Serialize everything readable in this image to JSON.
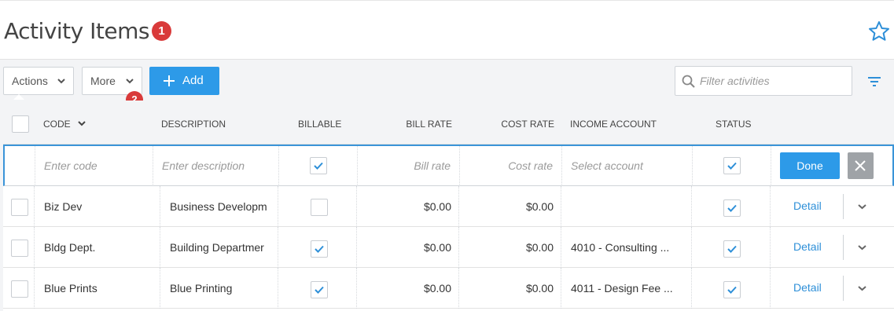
{
  "header": {
    "title": "Activity Items",
    "badge_1": "1"
  },
  "toolbar": {
    "actions_label": "Actions",
    "more_label": "More",
    "badge_2": "2",
    "add_label": "Add",
    "search_placeholder": "Filter activities"
  },
  "table": {
    "columns": {
      "code": "CODE",
      "description": "DESCRIPTION",
      "billable": "BILLABLE",
      "bill_rate": "BILL RATE",
      "cost_rate": "COST RATE",
      "income_account": "INCOME ACCOUNT",
      "status": "STATUS"
    },
    "new_row": {
      "code_placeholder": "Enter code",
      "description_placeholder": "Enter description",
      "billable": true,
      "bill_rate_placeholder": "Bill rate",
      "cost_rate_placeholder": "Cost rate",
      "account_placeholder": "Select account",
      "status": true,
      "done_label": "Done"
    },
    "rows": [
      {
        "code": "Biz Dev",
        "description": "Business Developm",
        "billable": false,
        "bill_rate": "$0.00",
        "cost_rate": "$0.00",
        "income_account": "",
        "status": true,
        "detail_label": "Detail"
      },
      {
        "code": "Bldg Dept.",
        "description": "Building Departmer",
        "billable": true,
        "bill_rate": "$0.00",
        "cost_rate": "$0.00",
        "income_account": "4010 - Consulting ...",
        "status": true,
        "detail_label": "Detail"
      },
      {
        "code": "Blue Prints",
        "description": "Blue Printing",
        "billable": true,
        "bill_rate": "$0.00",
        "cost_rate": "$0.00",
        "income_account": "4011 - Design Fee ...",
        "status": true,
        "detail_label": "Detail"
      }
    ]
  },
  "colors": {
    "accent": "#2d9ae8",
    "badge": "#d93a3a",
    "link": "#2d8fd8",
    "cancel": "#9fa3a7"
  },
  "icons": {
    "favorite": "star-icon",
    "search": "search-icon",
    "filter": "filter-icon",
    "add": "plus-icon",
    "cancel": "close-icon"
  }
}
